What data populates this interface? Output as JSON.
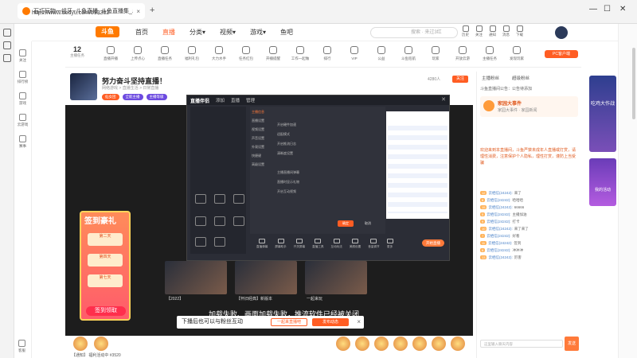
{
  "browser": {
    "tab_title": "石巧玩物一组牙~斗鱼直播_斗鱼直播集_斗鱼直播",
    "url": "https://www.douyu.com/593302"
  },
  "header": {
    "logo": "斗鱼",
    "nav": [
      "首页",
      "直播",
      "分类▾",
      "视频▾",
      "游戏▾",
      "鱼吧"
    ],
    "active_nav_index": 1,
    "search_placeholder": "搜索 · 来过3红",
    "user_icons": [
      "历史",
      "关注",
      "通知",
      "消息",
      "下载"
    ]
  },
  "leftnav": [
    "关注",
    "排行榜",
    "游戏",
    "云游戏",
    "赛事",
    "客服"
  ],
  "strip": {
    "level": "12",
    "level_label": "主播任务",
    "items": [
      "直播开播",
      "上传点心",
      "直播任务",
      "福利礼包",
      "大力水手",
      "任务红包",
      "开播提醒",
      "工作一起做",
      "排行",
      "VIP",
      "公益",
      "斗鱼巡航",
      "玩家",
      "开放云游",
      "主播任务",
      "发现玩家"
    ],
    "pc_tag": "PC客户端"
  },
  "room": {
    "title": "努力奋斗坚持直播！",
    "sub": "网络游戏 > 直播生活 > 日常直播",
    "tags": [
      "仙女团",
      "全能主播",
      "主播等级"
    ],
    "follow": "关注",
    "views": "4280人"
  },
  "player": {
    "thumb_caption": [
      "【2022】",
      "【怀旧经典】新版本",
      "一起来玩"
    ],
    "error_text": "加载失败、画面加载失败，推流软件已经被关闭",
    "banner_text": "下播后也可以与粉丝互动",
    "banner_btn1": "一起来直播吧",
    "banner_btn2": "发布动态"
  },
  "sign_card": {
    "title": "签到豪礼",
    "days": [
      "第二天",
      "第四天",
      "第七天"
    ],
    "button": "签到领取"
  },
  "dialog": {
    "brand": "直播伴侣",
    "tabs": [
      "添加",
      "直播",
      "管理"
    ],
    "menu": [
      "主播信息",
      "直播设置",
      "视频设置",
      "声音设置",
      "外观设置",
      "快捷键",
      "高级设置"
    ],
    "active_menu_index": 0,
    "options": [
      "开启硬件加速",
      "适配模式",
      "开启推流日志",
      "清晰度设置",
      "主播直播间弹幕",
      "直播时显示礼物",
      "开启互动视频"
    ],
    "ok": "确定",
    "cancel": "取消",
    "toolbar": [
      "直播弹幕",
      "屏幕助手",
      "开关屏幕",
      "直播工具",
      "互动玩法",
      "美颜设置",
      "音量调节",
      "更多"
    ],
    "live_btn": "开始直播"
  },
  "chat": {
    "tabs": [
      "主播粉丝",
      "超级粉丝"
    ],
    "notice": "斗鱼直播间公告：公告待添加",
    "family_title": "家园大事件",
    "family_sub": "家园大事件 · 家园新闻",
    "system_message": "欢迎来到本直播间，斗鱼严禁未成年人直播或打赏，请理性消费，注意保护个人隐私，理性打赏，谨防上当受骗",
    "messages": [
      {
        "lv": "12",
        "name": "云栖信(24242):",
        "text": "来了"
      },
      {
        "lv": "8",
        "name": "云栖信(24242):",
        "text": "哈哈哈"
      },
      {
        "lv": "15",
        "name": "云栖信(24242):",
        "text": "66666"
      },
      {
        "lv": "5",
        "name": "云栖信(24242):",
        "text": "主播加油"
      },
      {
        "lv": "9",
        "name": "云栖信(24242):",
        "text": "打卡"
      },
      {
        "lv": "10",
        "name": "云栖信(24242):",
        "text": "来了来了"
      },
      {
        "lv": "7",
        "name": "云栖信(24242):",
        "text": "好看"
      },
      {
        "lv": "11",
        "name": "云栖信(24242):",
        "text": "签到"
      },
      {
        "lv": "6",
        "name": "云栖信(24242):",
        "text": "冲冲冲"
      },
      {
        "lv": "13",
        "name": "云栖信(24242):",
        "text": "厉害"
      }
    ],
    "input_placeholder": "这里输入聊天内容",
    "send": "发送"
  },
  "promo": {
    "p1": "吃鸡大作战",
    "p2": "我的活动"
  },
  "giftbar": {
    "bottom_text": "【通知】 福利活动中 #3520"
  }
}
